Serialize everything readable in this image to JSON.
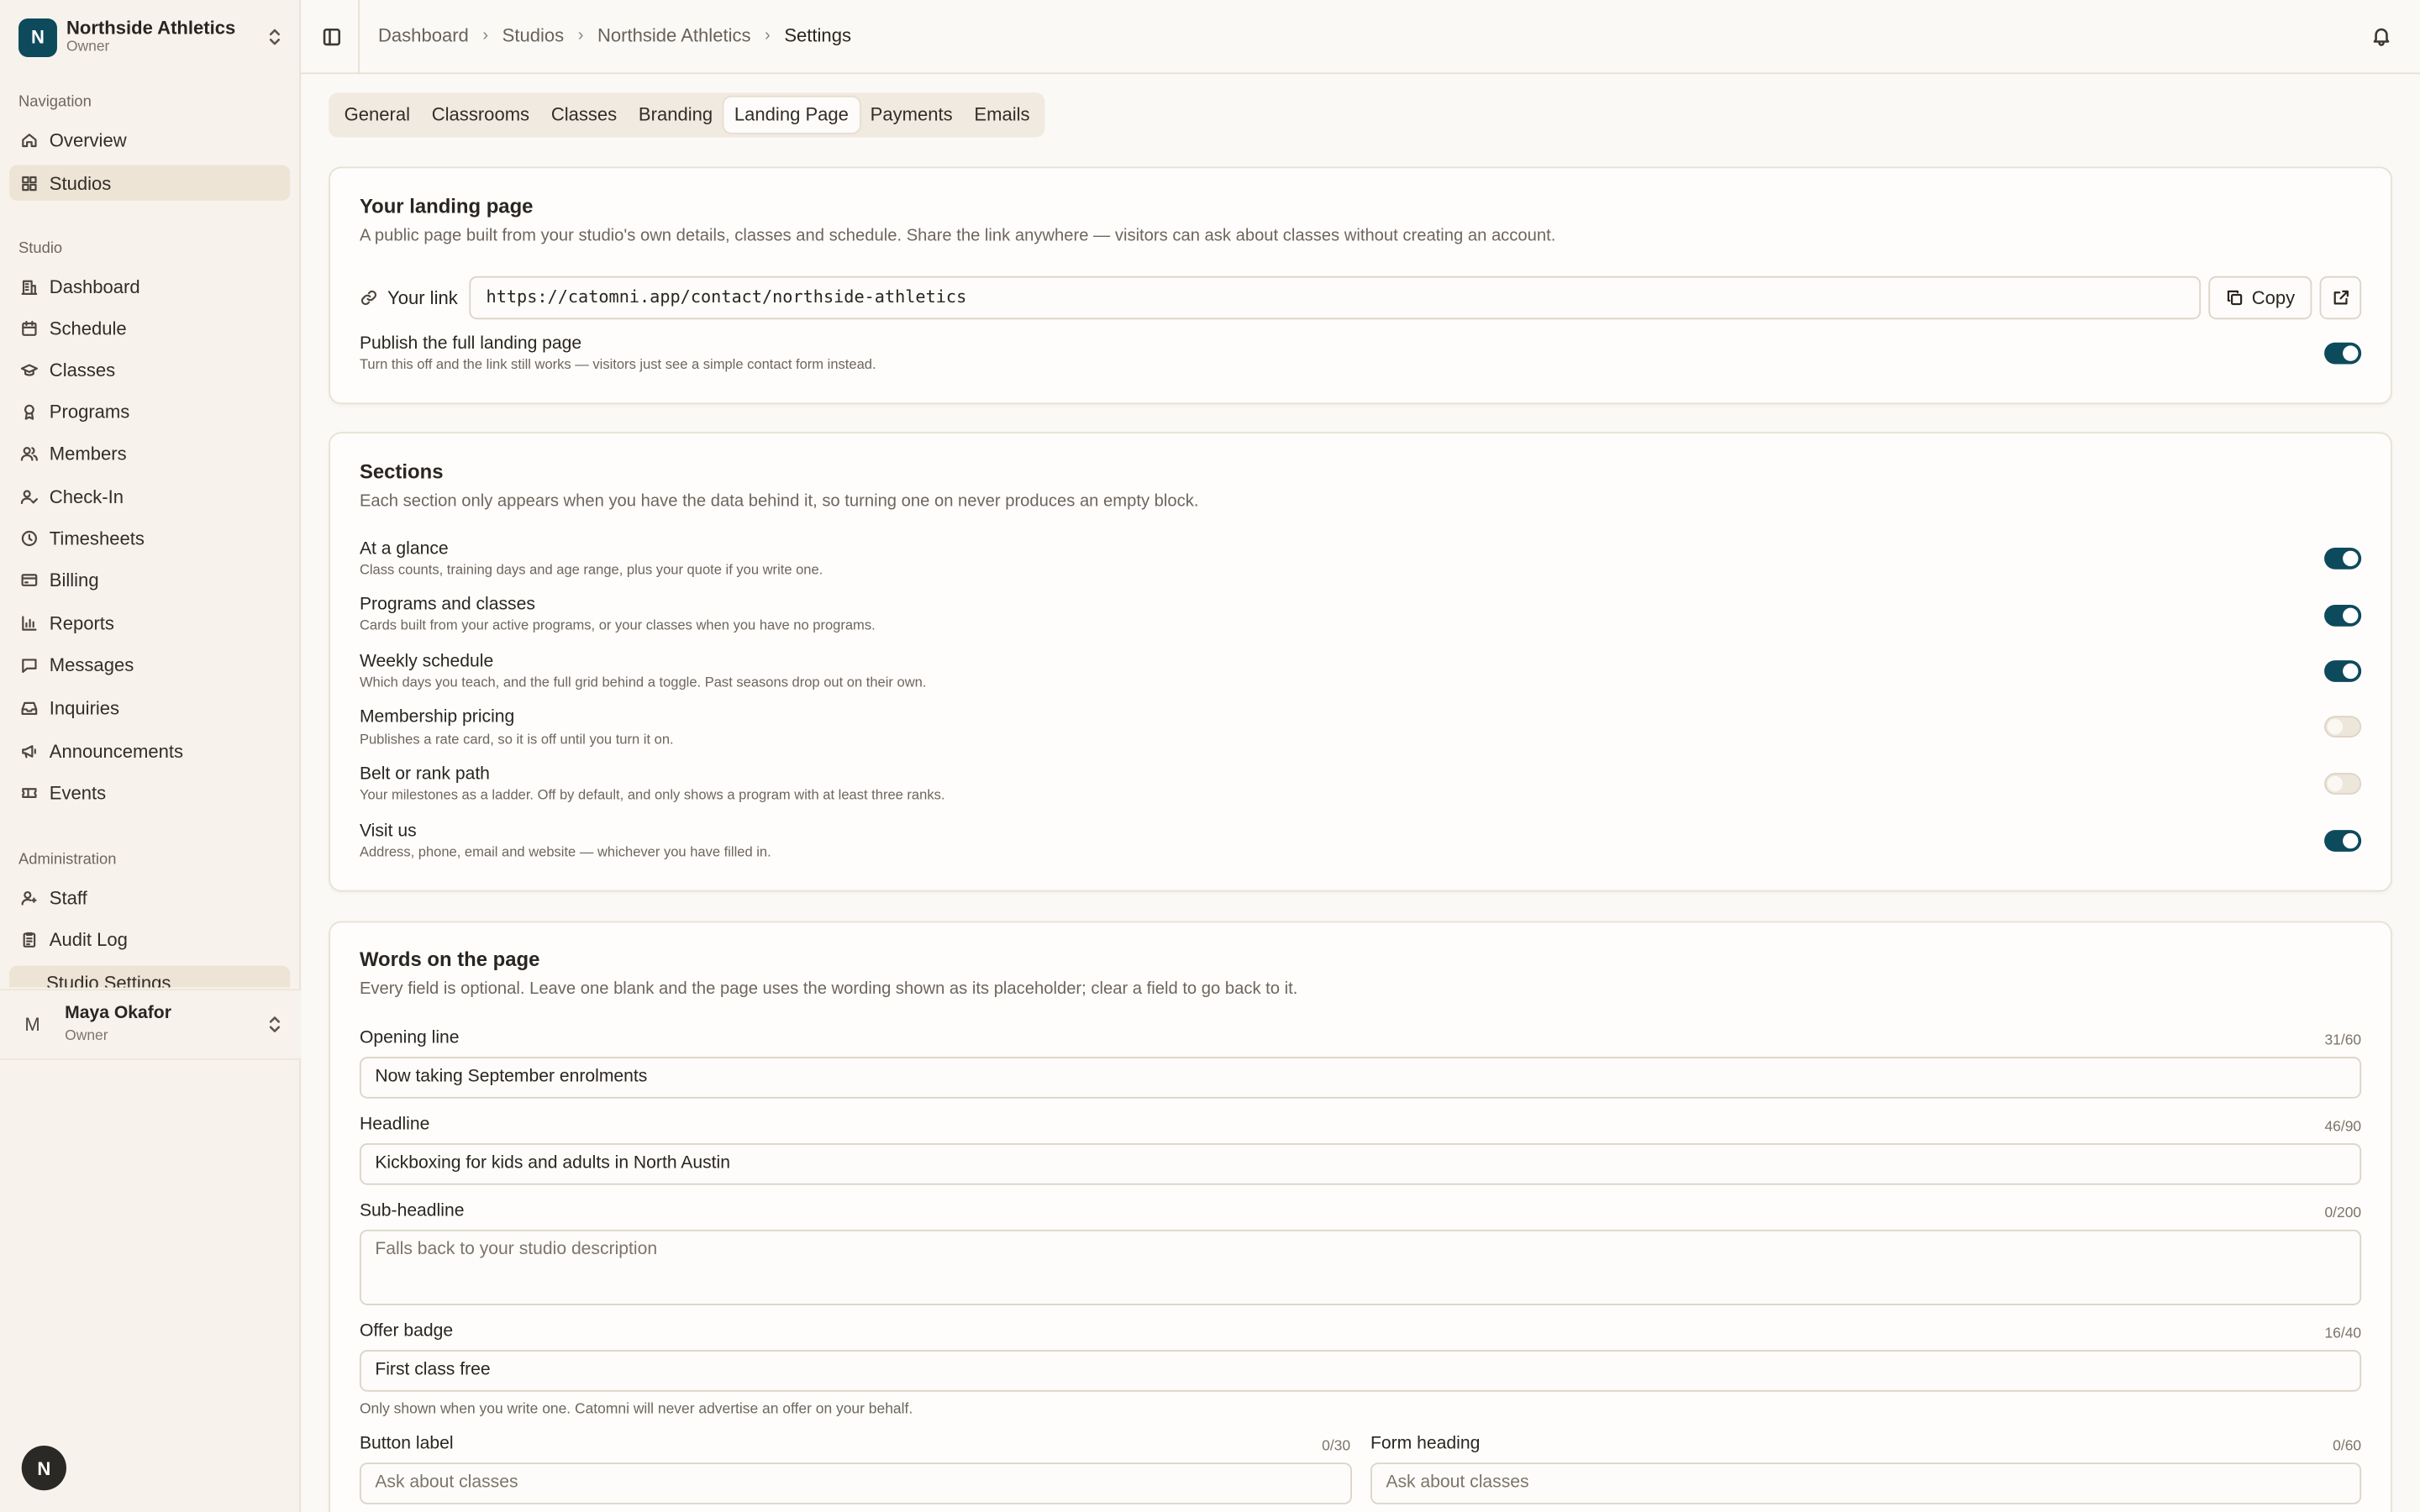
{
  "org": {
    "initial": "N",
    "name": "Northside Athletics",
    "role": "Owner"
  },
  "nav_groups": {
    "navigation": "Navigation",
    "studio": "Studio",
    "administration": "Administration"
  },
  "nav": {
    "overview": "Overview",
    "studios": "Studios",
    "dashboard": "Dashboard",
    "schedule": "Schedule",
    "classes": "Classes",
    "programs": "Programs",
    "members": "Members",
    "checkin": "Check-In",
    "timesheets": "Timesheets",
    "billing": "Billing",
    "reports": "Reports",
    "messages": "Messages",
    "inquiries": "Inquiries",
    "announcements": "Announcements",
    "events": "Events",
    "staff": "Staff",
    "audit_log": "Audit Log",
    "studio_settings": "Studio Settings"
  },
  "user": {
    "initial": "M",
    "name": "Maya Okafor",
    "role": "Owner"
  },
  "fab_initial": "N",
  "breadcrumb": [
    "Dashboard",
    "Studios",
    "Northside Athletics",
    "Settings"
  ],
  "tabs": [
    "General",
    "Classrooms",
    "Classes",
    "Branding",
    "Landing Page",
    "Payments",
    "Emails"
  ],
  "active_tab": "Landing Page",
  "landing": {
    "title": "Your landing page",
    "desc": "A public page built from your studio's own details, classes and schedule. Share the link anywhere — visitors can ask about classes without creating an account.",
    "link_label": "Your link",
    "link": "https://catomni.app/contact/northside-athletics",
    "copy": "Copy",
    "publish_title": "Publish the full landing page",
    "publish_desc": "Turn this off and the link still works — visitors just see a simple contact form instead.",
    "publish_on": true
  },
  "sections": {
    "title": "Sections",
    "desc": "Each section only appears when you have the data behind it, so turning one on never produces an empty block.",
    "items": [
      {
        "title": "At a glance",
        "desc": "Class counts, training days and age range, plus your quote if you write one.",
        "on": true
      },
      {
        "title": "Programs and classes",
        "desc": "Cards built from your active programs, or your classes when you have no programs.",
        "on": true
      },
      {
        "title": "Weekly schedule",
        "desc": "Which days you teach, and the full grid behind a toggle. Past seasons drop out on their own.",
        "on": true
      },
      {
        "title": "Membership pricing",
        "desc": "Publishes a rate card, so it is off until you turn it on.",
        "on": false
      },
      {
        "title": "Belt or rank path",
        "desc": "Your milestones as a ladder. Off by default, and only shows a program with at least three ranks.",
        "on": false
      },
      {
        "title": "Visit us",
        "desc": "Address, phone, email and website — whichever you have filled in.",
        "on": true
      }
    ]
  },
  "words": {
    "title": "Words on the page",
    "desc": "Every field is optional. Leave one blank and the page uses the wording shown as its placeholder; clear a field to go back to it.",
    "opening": {
      "label": "Opening line",
      "count": "31/60",
      "value": "Now taking September enrolments"
    },
    "headline": {
      "label": "Headline",
      "count": "46/90",
      "value": "Kickboxing for kids and adults in North Austin"
    },
    "subheadline": {
      "label": "Sub-headline",
      "count": "0/200",
      "placeholder": "Falls back to your studio description"
    },
    "offer": {
      "label": "Offer badge",
      "count": "16/40",
      "value": "First class free",
      "help": "Only shown when you write one. Catomni will never advertise an offer on your behalf."
    },
    "button_label": {
      "label": "Button label",
      "count": "0/30",
      "placeholder": "Ask about classes"
    },
    "form_heading": {
      "label": "Form heading",
      "count": "0/60",
      "placeholder": "Ask about classes"
    }
  }
}
